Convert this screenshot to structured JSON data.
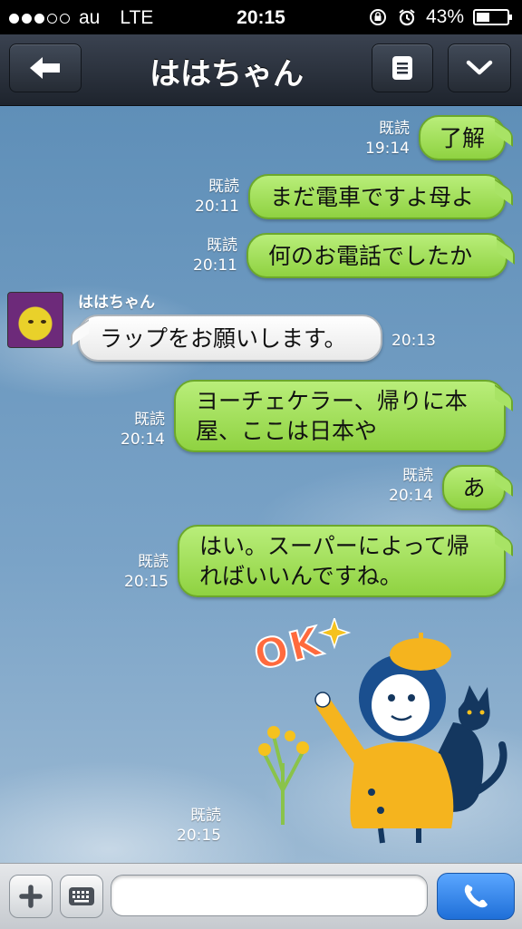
{
  "status_bar": {
    "carrier": "au",
    "network": "LTE",
    "time": "20:15",
    "battery": "43%",
    "battery_level": 0.43,
    "icons": [
      "signal-dots",
      "rotation-lock-icon",
      "alarm-icon",
      "battery-icon"
    ]
  },
  "header": {
    "title": "ははちゃん",
    "back_icon": "arrow-left-icon",
    "menu_icon": "menu-icon",
    "collapse_icon": "chevron-down-icon"
  },
  "chat": {
    "sender_name": "ははちゃん",
    "messages": [
      {
        "from": "me",
        "text": "了解",
        "read": "既読",
        "time": "19:14"
      },
      {
        "from": "me",
        "text": "まだ電車ですよ母よ",
        "read": "既読",
        "time": "20:11"
      },
      {
        "from": "me",
        "text": "何のお電話でしたか",
        "read": "既読",
        "time": "20:11"
      },
      {
        "from": "them",
        "text": "ラップをお願いします。",
        "time": "20:13"
      },
      {
        "from": "me",
        "text": "ヨーチェケラー、帰りに本屋、ここは日本や",
        "read": "既読",
        "time": "20:14"
      },
      {
        "from": "me",
        "text": "あ",
        "read": "既読",
        "time": "20:14"
      },
      {
        "from": "me",
        "text": "はい。スーパーによって帰ればいいんですね。",
        "read": "既読",
        "time": "20:15"
      }
    ],
    "sticker": {
      "text": "OK",
      "read": "既読",
      "time": "20:15",
      "colors": {
        "coat": "#f5b41e",
        "hair": "#1a4f8f",
        "ok": "#ff6a3d"
      }
    }
  },
  "input_bar": {
    "plus_icon": "plus-icon",
    "keyboard_icon": "keyboard-icon",
    "placeholder": "",
    "call_icon": "phone-icon"
  },
  "colors": {
    "my_bubble": "#9bdc52",
    "their_bubble": "#f4f4f4",
    "sky": "#6f9ac1",
    "nav": "#2a313c",
    "call_button": "#2f7fe6"
  }
}
